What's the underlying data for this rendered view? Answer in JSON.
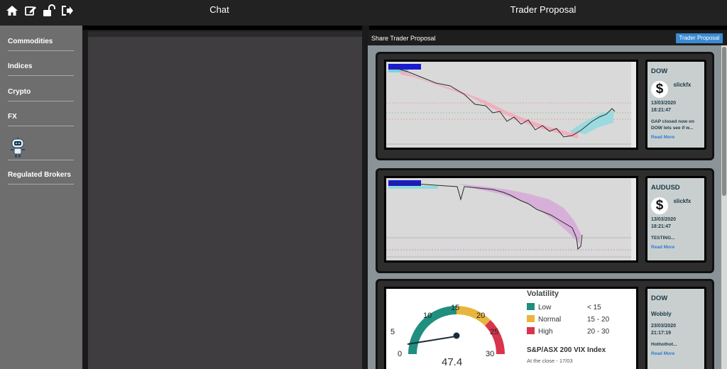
{
  "top_nav": {
    "icons": [
      "home-icon",
      "edit-icon",
      "unlock-icon",
      "logout-icon"
    ],
    "chat_title": "Chat",
    "trader_title": "Trader Proposal"
  },
  "sidebar": {
    "items": [
      {
        "label": "Commodities"
      },
      {
        "label": "Indices"
      },
      {
        "label": "Crypto"
      },
      {
        "label": "FX"
      },
      {
        "label": "Regulated Brokers"
      }
    ],
    "robot_icon": "robot-icon"
  },
  "proposal_panel": {
    "header_label": "Share Trader Proposal",
    "button_label": "Trader Proposal",
    "cards": [
      {
        "symbol": "DOW",
        "user": "slickfx",
        "date": "13/03/2020",
        "time": "18:21:47",
        "text": "GAP closed now on DOW lets see if w...",
        "read_more": "Read More",
        "chart_kind": "price-chart"
      },
      {
        "symbol": "AUDUSD",
        "user": "slickfx",
        "date": "13/03/2020",
        "time": "18:21:47",
        "text": "TESTING...",
        "read_more": "Read More",
        "chart_kind": "price-chart"
      },
      {
        "symbol": "DOW",
        "user": "Wobbly",
        "date": "23/03/2020",
        "time": "21:17:19",
        "text": "Hothothot...",
        "read_more": "Read More",
        "chart_kind": "gauge"
      }
    ],
    "gauge": {
      "ticks": [
        "0",
        "5",
        "10",
        "15",
        "20",
        "25",
        "30"
      ],
      "value": "47.4",
      "legend_title": "Volatility",
      "legend": [
        {
          "label": "Low",
          "range": "< 15",
          "color": "#1f8f7f"
        },
        {
          "label": "Normal",
          "range": "15 - 20",
          "color": "#e8b63e"
        },
        {
          "label": "High",
          "range": "20 - 30",
          "color": "#d9344d"
        }
      ],
      "index_name": "S&P/ASX 200 VIX Index",
      "close_note": "At the close - 17/03"
    }
  },
  "colors": {
    "accent_button": "#3a8ad1",
    "read_more": "#2e7bd1",
    "sidebar_bg": "#6e6e6e"
  }
}
